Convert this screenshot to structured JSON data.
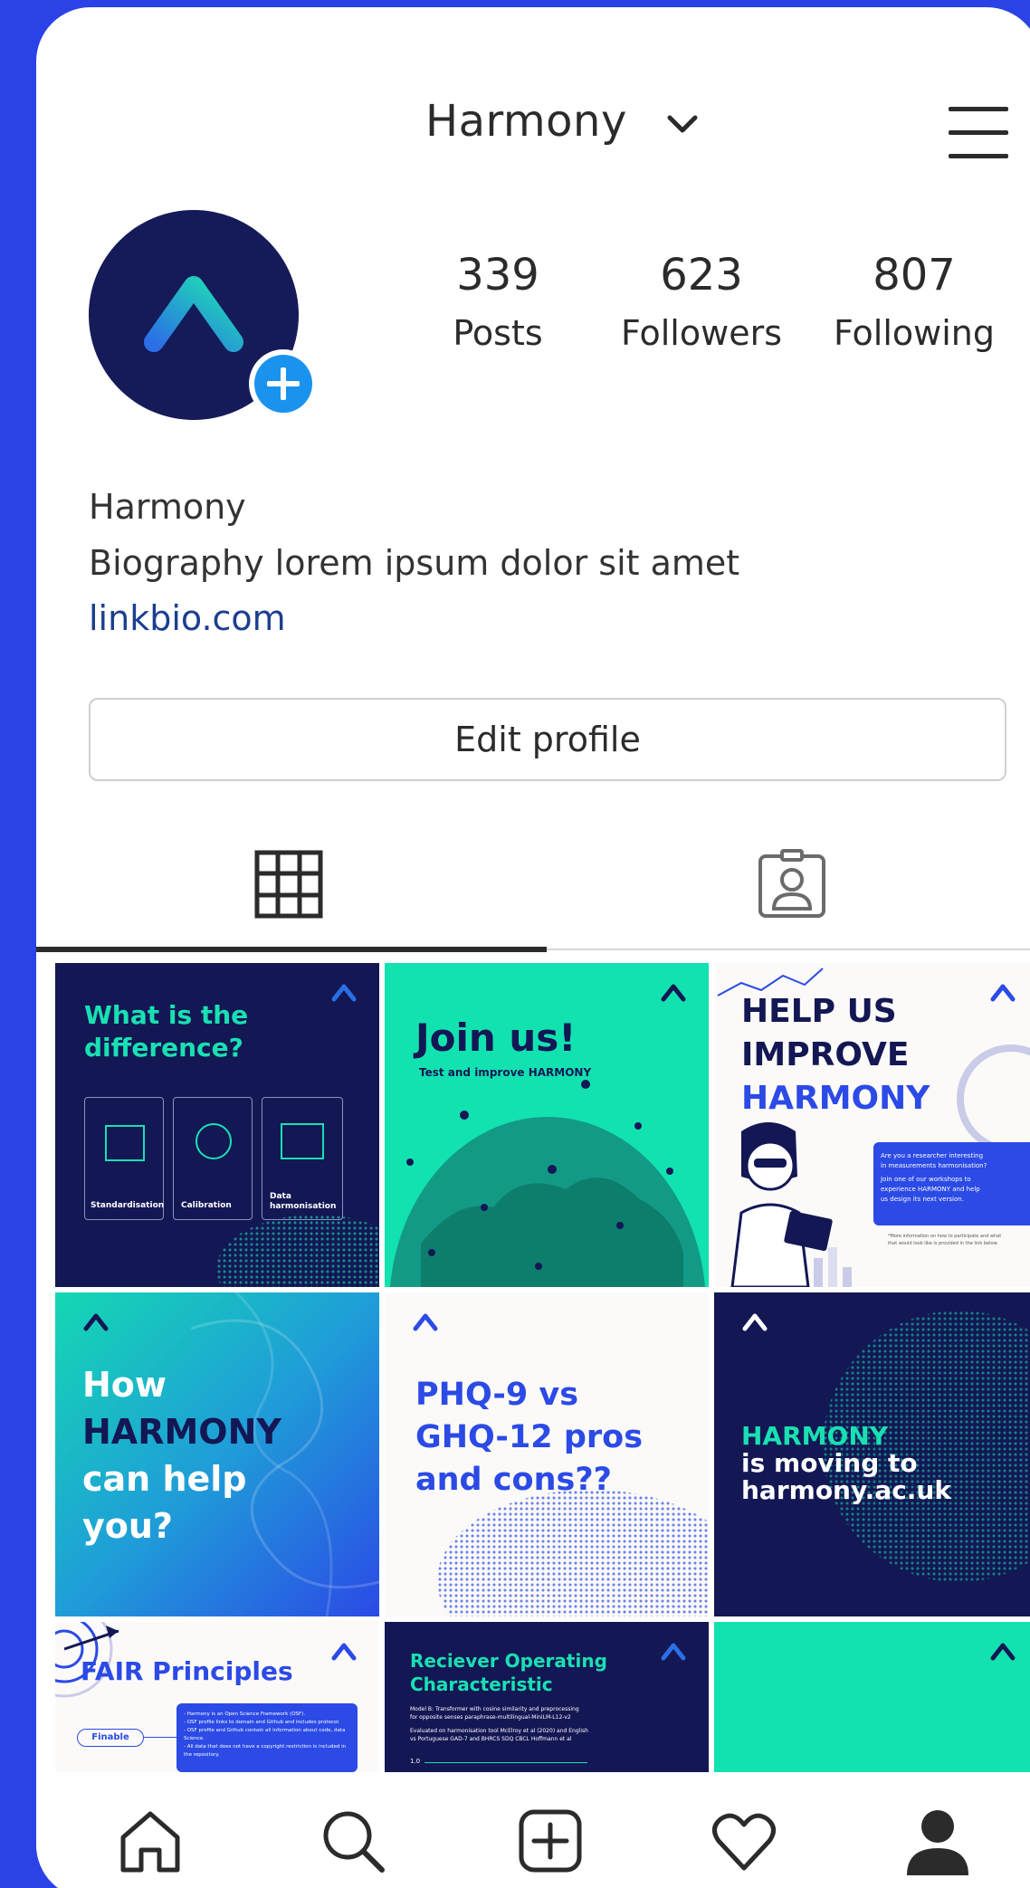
{
  "header": {
    "username": "Harmony"
  },
  "profile": {
    "stats": [
      {
        "count": "339",
        "label": "Posts"
      },
      {
        "count": "623",
        "label": "Followers"
      },
      {
        "count": "807",
        "label": "Following"
      }
    ],
    "name": "Harmony",
    "bio": "Biography lorem ipsum dolor sit amet",
    "link": "linkbio.com",
    "edit_label": "Edit profile"
  },
  "posts": [
    {
      "title_1": "What is the",
      "title_2": "difference?",
      "card_1": "Standardisation",
      "card_2": "Calibration",
      "card_3a": "Data",
      "card_3b": "harmonisation"
    },
    {
      "title": "Join us!",
      "subtitle": "Test and improve HARMONY"
    },
    {
      "line_1": "HELP US",
      "line_2": "IMPROVE",
      "line_3": "HARMONY",
      "box_1": "Are you a researcher interesting",
      "box_2": "in measurements harmonisation?",
      "box_3": "Join one of our workshops to",
      "box_4": "experience HARMONY and help",
      "box_5": "us design its next version.",
      "note_1": "*More information on how to participate and what",
      "note_2": "that would look like is provided in the link below."
    },
    {
      "line_1": "How",
      "line_2": "HARMONY",
      "line_3": "can help",
      "line_4": "you?"
    },
    {
      "line_1": "PHQ-9 vs",
      "line_2": "GHQ-12 pros",
      "line_3": "and cons??"
    },
    {
      "line_1": "HARMONY",
      "line_2": "is moving to",
      "line_3": "harmony.ac.uk"
    },
    {
      "title_a": "FAIR",
      "title_b": " Principles",
      "pill": "Finable",
      "b1": "- Harmony is an Open Science Framework (OSF).",
      "b2": "- OSF profile links to domain and Github and includes protocol.",
      "b3": "- OSF profile and Github contain all information about code, data Science.",
      "b4": "- All data that does not have a copyright restriction is included in the repository."
    },
    {
      "title_1": "Reciever Operating",
      "title_2": "Characteristic",
      "m1": "Model B: Transformer with cosine similarity and preprocessing",
      "m2": "for opposite senses paraphrase-multilingual-MiniLM-L12-v2",
      "m3": "Evaluated on harmonisation tool McElroy et al (2020) and English",
      "m4": "vs Portuguese GAD-7 and BHRCS SDQ CBCL Hoffmann et al",
      "axis": "1.0"
    },
    {}
  ],
  "colors": {
    "frame": "#2a42e6",
    "navy": "#131754",
    "teal": "#12e2b0",
    "blue": "#2b4ae6",
    "link": "#1b3f8f",
    "add": "#1a93ee"
  }
}
